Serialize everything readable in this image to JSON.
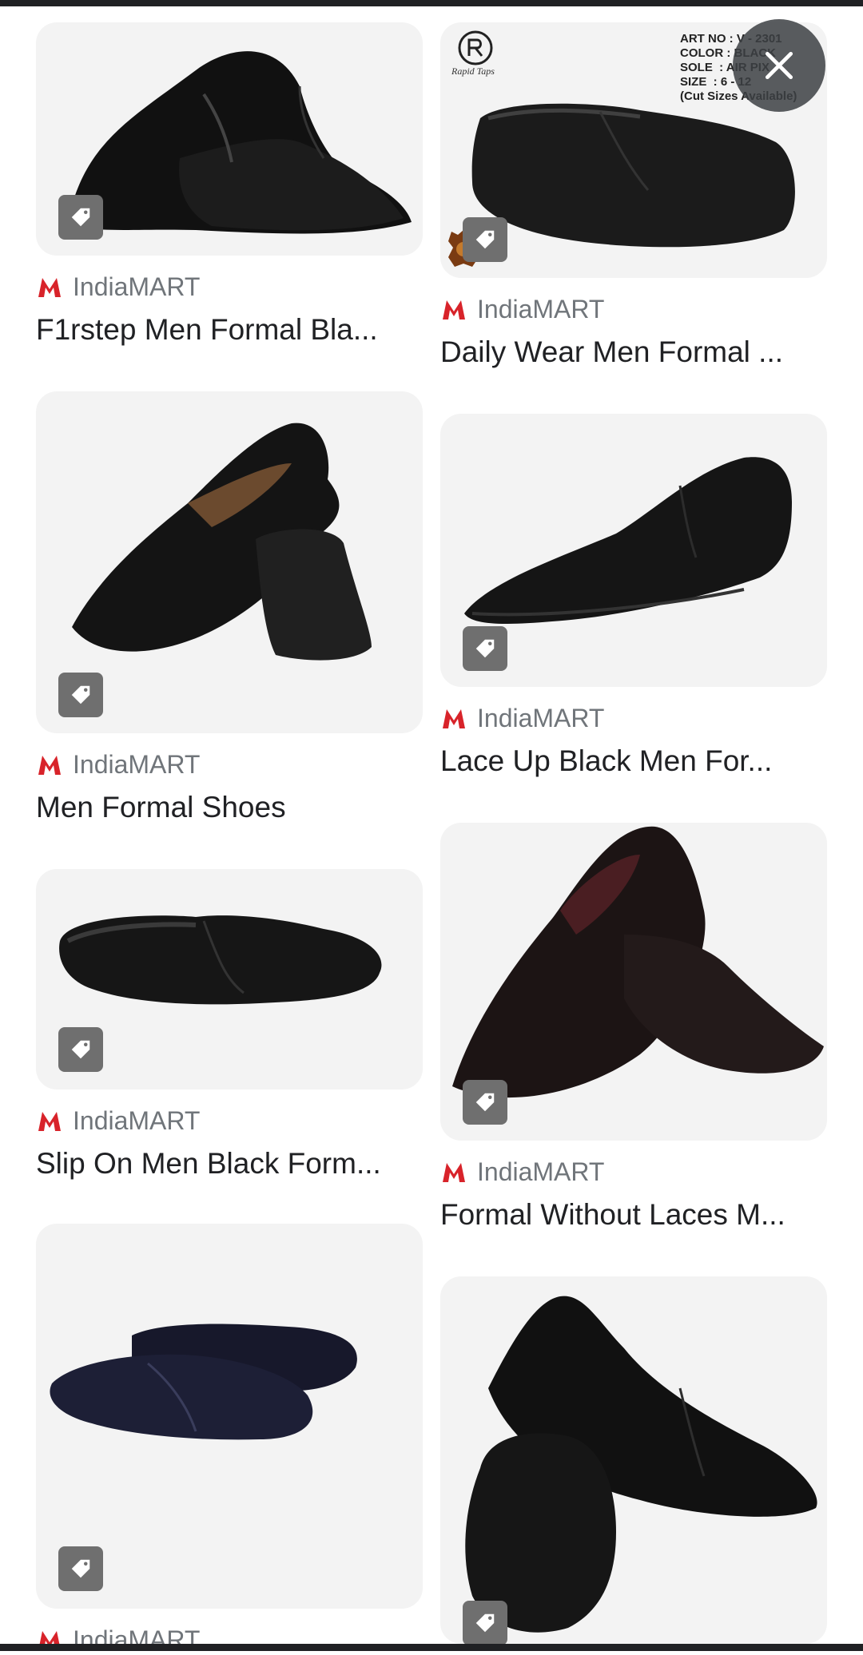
{
  "results": [
    {
      "source": "IndiaMART",
      "title": "F1rstep Men Formal Bla..."
    },
    {
      "source": "IndiaMART",
      "title": "Daily Wear Men Formal ..."
    },
    {
      "source": "IndiaMART",
      "title": "Men Formal Shoes"
    },
    {
      "source": "IndiaMART",
      "title": "Lace Up Black Men For..."
    },
    {
      "source": "IndiaMART",
      "title": "Slip On Men Black Form..."
    },
    {
      "source": "IndiaMART",
      "title": "Formal Without Laces M..."
    },
    {
      "source": "IndiaMART",
      "title": ""
    },
    {
      "source": "",
      "title": ""
    }
  ],
  "product_image_text": {
    "brand": "Rapid Taps",
    "spec_lines": "ART NO : V - 2301\nCOLOR : BLACK\nSOLE  : AIR PIX\nSIZE  : 6 - 12\n(Cut Sizes Available)"
  },
  "icons": {
    "close": "close-icon",
    "tag": "tag-icon",
    "source_logo": "indiamart-logo"
  },
  "colors": {
    "text_primary": "#202124",
    "text_secondary": "#70757a",
    "indiamart_red": "#d8232a",
    "tag_bg": "#6f6f6f"
  }
}
